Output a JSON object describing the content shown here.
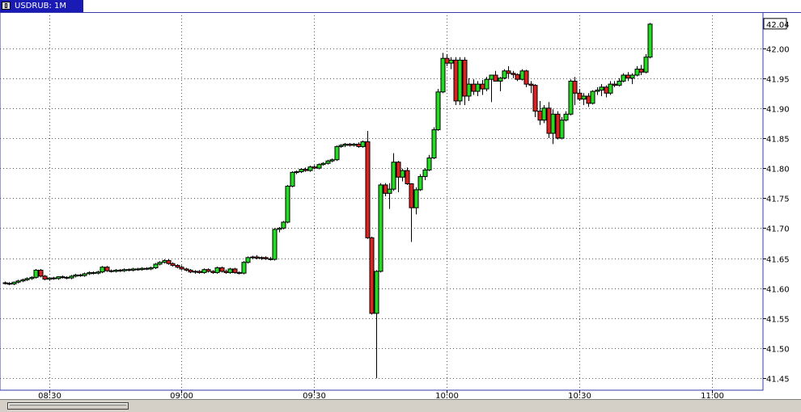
{
  "window": {
    "tab_label": "USDRUB: 1M"
  },
  "colors": {
    "up": "#22dd22",
    "down": "#dd2222",
    "grid": "#555555",
    "wick": "#000000",
    "axis": "#3a3aa8"
  },
  "chart_data": {
    "type": "candlestick",
    "symbol": "USDRUB",
    "timeframe": "1M",
    "ylim": [
      41.43,
      42.06
    ],
    "y_ticks": [
      "42.00",
      "41.95",
      "41.90",
      "41.85",
      "41.80",
      "41.75",
      "41.70",
      "41.65",
      "41.60",
      "41.55",
      "41.50",
      "41.45"
    ],
    "x_ticks": [
      {
        "label": "08:30",
        "minute": 10
      },
      {
        "label": "09:00",
        "minute": 40
      },
      {
        "label": "09:30",
        "minute": 70
      },
      {
        "label": "10:00",
        "minute": 100
      },
      {
        "label": "10:30",
        "minute": 130
      },
      {
        "label": "11:00",
        "minute": 160
      }
    ],
    "last_price": "42.04",
    "candles": [
      [
        41.608,
        41.611,
        41.606,
        41.609
      ],
      [
        41.608,
        41.61,
        41.605,
        41.607
      ],
      [
        41.607,
        41.611,
        41.605,
        41.61
      ],
      [
        41.61,
        41.614,
        41.608,
        41.612
      ],
      [
        41.612,
        41.616,
        41.61,
        41.614
      ],
      [
        41.614,
        41.618,
        41.612,
        41.616
      ],
      [
        41.616,
        41.62,
        41.614,
        41.618
      ],
      [
        41.618,
        41.632,
        41.616,
        41.63
      ],
      [
        41.63,
        41.632,
        41.618,
        41.62
      ],
      [
        41.62,
        41.622,
        41.613,
        41.615
      ],
      [
        41.615,
        41.618,
        41.613,
        41.617
      ],
      [
        41.617,
        41.619,
        41.614,
        41.616
      ],
      [
        41.616,
        41.62,
        41.614,
        41.619
      ],
      [
        41.619,
        41.621,
        41.616,
        41.618
      ],
      [
        41.618,
        41.62,
        41.615,
        41.617
      ],
      [
        41.617,
        41.622,
        41.615,
        41.62
      ],
      [
        41.62,
        41.624,
        41.618,
        41.622
      ],
      [
        41.622,
        41.624,
        41.619,
        41.621
      ],
      [
        41.621,
        41.626,
        41.619,
        41.624
      ],
      [
        41.624,
        41.628,
        41.622,
        41.626
      ],
      [
        41.626,
        41.628,
        41.623,
        41.625
      ],
      [
        41.625,
        41.629,
        41.623,
        41.627
      ],
      [
        41.627,
        41.637,
        41.625,
        41.635
      ],
      [
        41.635,
        41.637,
        41.627,
        41.629
      ],
      [
        41.629,
        41.631,
        41.626,
        41.628
      ],
      [
        41.628,
        41.632,
        41.626,
        41.63
      ],
      [
        41.63,
        41.632,
        41.627,
        41.629
      ],
      [
        41.629,
        41.633,
        41.627,
        41.631
      ],
      [
        41.631,
        41.633,
        41.628,
        41.63
      ],
      [
        41.63,
        41.634,
        41.628,
        41.632
      ],
      [
        41.632,
        41.634,
        41.629,
        41.631
      ],
      [
        41.631,
        41.635,
        41.629,
        41.633
      ],
      [
        41.633,
        41.635,
        41.63,
        41.632
      ],
      [
        41.632,
        41.636,
        41.63,
        41.634
      ],
      [
        41.634,
        41.642,
        41.632,
        41.64
      ],
      [
        41.64,
        41.645,
        41.638,
        41.643
      ],
      [
        41.643,
        41.648,
        41.641,
        41.646
      ],
      [
        41.646,
        41.648,
        41.639,
        41.641
      ],
      [
        41.641,
        41.643,
        41.636,
        41.638
      ],
      [
        41.638,
        41.64,
        41.633,
        41.635
      ],
      [
        41.635,
        41.638,
        41.63,
        41.632
      ],
      [
        41.632,
        41.634,
        41.628,
        41.63
      ],
      [
        41.63,
        41.632,
        41.625,
        41.627
      ],
      [
        41.627,
        41.63,
        41.624,
        41.628
      ],
      [
        41.628,
        41.63,
        41.624,
        41.626
      ],
      [
        41.626,
        41.633,
        41.624,
        41.631
      ],
      [
        41.631,
        41.633,
        41.626,
        41.628
      ],
      [
        41.628,
        41.63,
        41.624,
        41.626
      ],
      [
        41.626,
        41.636,
        41.624,
        41.634
      ],
      [
        41.634,
        41.636,
        41.626,
        41.628
      ],
      [
        41.628,
        41.631,
        41.624,
        41.626
      ],
      [
        41.626,
        41.634,
        41.624,
        41.632
      ],
      [
        41.632,
        41.634,
        41.624,
        41.626
      ],
      [
        41.626,
        41.628,
        41.623,
        41.625
      ],
      [
        41.625,
        41.645,
        41.623,
        41.643
      ],
      [
        41.643,
        41.653,
        41.641,
        41.651
      ],
      [
        41.651,
        41.654,
        41.648,
        41.652
      ],
      [
        41.652,
        41.655,
        41.648,
        41.65
      ],
      [
        41.65,
        41.653,
        41.647,
        41.651
      ],
      [
        41.651,
        41.653,
        41.647,
        41.649
      ],
      [
        41.649,
        41.652,
        41.646,
        41.648
      ],
      [
        41.648,
        41.7,
        41.646,
        41.698
      ],
      [
        41.698,
        41.702,
        41.693,
        41.7
      ],
      [
        41.7,
        41.712,
        41.698,
        41.71
      ],
      [
        41.71,
        41.772,
        41.708,
        41.77
      ],
      [
        41.77,
        41.795,
        41.768,
        41.793
      ],
      [
        41.793,
        41.796,
        41.79,
        41.794
      ],
      [
        41.794,
        41.8,
        41.792,
        41.798
      ],
      [
        41.798,
        41.801,
        41.794,
        41.796
      ],
      [
        41.796,
        41.804,
        41.794,
        41.802
      ],
      [
        41.802,
        41.805,
        41.798,
        41.8
      ],
      [
        41.8,
        41.808,
        41.798,
        41.806
      ],
      [
        41.806,
        41.81,
        41.804,
        41.808
      ],
      [
        41.808,
        41.814,
        41.806,
        41.812
      ],
      [
        41.812,
        41.816,
        41.81,
        41.814
      ],
      [
        41.814,
        41.838,
        41.812,
        41.836
      ],
      [
        41.836,
        41.84,
        41.834,
        41.838
      ],
      [
        41.838,
        41.842,
        41.835,
        41.84
      ],
      [
        41.84,
        41.842,
        41.836,
        41.838
      ],
      [
        41.838,
        41.842,
        41.836,
        41.84
      ],
      [
        41.84,
        41.843,
        41.834,
        41.836
      ],
      [
        41.836,
        41.846,
        41.834,
        41.844
      ],
      [
        41.844,
        41.862,
        41.682,
        41.684
      ],
      [
        41.684,
        41.686,
        41.556,
        41.558
      ],
      [
        41.558,
        41.63,
        41.45,
        41.628
      ],
      [
        41.628,
        41.775,
        41.626,
        41.772
      ],
      [
        41.772,
        41.775,
        41.753,
        41.758
      ],
      [
        41.758,
        41.775,
        41.732,
        41.765
      ],
      [
        41.765,
        41.825,
        41.762,
        41.81
      ],
      [
        41.81,
        41.812,
        41.76,
        41.785
      ],
      [
        41.785,
        41.799,
        41.778,
        41.796
      ],
      [
        41.796,
        41.801,
        41.772,
        41.774
      ],
      [
        41.774,
        41.775,
        41.677,
        41.734
      ],
      [
        41.734,
        41.768,
        41.723,
        41.764
      ],
      [
        41.764,
        41.79,
        41.762,
        41.786
      ],
      [
        41.786,
        41.8,
        41.78,
        41.797
      ],
      [
        41.797,
        41.822,
        41.795,
        41.817
      ],
      [
        41.817,
        41.868,
        41.815,
        41.864
      ],
      [
        41.864,
        41.932,
        41.862,
        41.927
      ],
      [
        41.927,
        41.992,
        41.925,
        41.983
      ],
      [
        41.983,
        41.99,
        41.97,
        41.975
      ],
      [
        41.975,
        41.985,
        41.965,
        41.98
      ],
      [
        41.98,
        41.985,
        41.905,
        41.912
      ],
      [
        41.912,
        41.985,
        41.905,
        41.98
      ],
      [
        41.98,
        41.985,
        41.905,
        41.92
      ],
      [
        41.92,
        41.95,
        41.912,
        41.94
      ],
      [
        41.94,
        41.948,
        41.922,
        41.928
      ],
      [
        41.928,
        41.945,
        41.92,
        41.94
      ],
      [
        41.94,
        41.947,
        41.922,
        41.932
      ],
      [
        41.932,
        41.952,
        41.928,
        41.948
      ],
      [
        41.948,
        41.952,
        41.91,
        41.955
      ],
      [
        41.955,
        41.962,
        41.948,
        41.945
      ],
      [
        41.945,
        41.952,
        41.928,
        41.95
      ],
      [
        41.95,
        41.965,
        41.948,
        41.962
      ],
      [
        41.962,
        41.97,
        41.95,
        41.958
      ],
      [
        41.958,
        41.962,
        41.95,
        41.956
      ],
      [
        41.956,
        41.958,
        41.945,
        41.948
      ],
      [
        41.948,
        41.965,
        41.946,
        41.962
      ],
      [
        41.962,
        41.964,
        41.935,
        41.94
      ],
      [
        41.94,
        41.945,
        41.925,
        41.938
      ],
      [
        41.938,
        41.94,
        41.885,
        41.895
      ],
      [
        41.895,
        41.912,
        41.872,
        41.88
      ],
      [
        41.88,
        41.905,
        41.875,
        41.9
      ],
      [
        41.9,
        41.91,
        41.85,
        41.858
      ],
      [
        41.858,
        41.898,
        41.84,
        41.89
      ],
      [
        41.89,
        41.895,
        41.848,
        41.85
      ],
      [
        41.85,
        41.885,
        41.848,
        41.88
      ],
      [
        41.88,
        41.895,
        41.878,
        41.89
      ],
      [
        41.89,
        41.948,
        41.888,
        41.945
      ],
      [
        41.945,
        41.952,
        41.905,
        41.925
      ],
      [
        41.925,
        41.932,
        41.912,
        41.915
      ],
      [
        41.915,
        41.925,
        41.905,
        41.92
      ],
      [
        41.92,
        41.925,
        41.902,
        41.908
      ],
      [
        41.908,
        41.93,
        41.906,
        41.928
      ],
      [
        41.928,
        41.935,
        41.922,
        41.93
      ],
      [
        41.93,
        41.94,
        41.92,
        41.935
      ],
      [
        41.935,
        41.938,
        41.918,
        41.925
      ],
      [
        41.925,
        41.945,
        41.922,
        41.94
      ],
      [
        41.94,
        41.945,
        41.935,
        41.938
      ],
      [
        41.938,
        41.95,
        41.936,
        41.945
      ],
      [
        41.945,
        41.958,
        41.943,
        41.955
      ],
      [
        41.955,
        41.96,
        41.945,
        41.95
      ],
      [
        41.95,
        41.958,
        41.94,
        41.955
      ],
      [
        41.955,
        41.97,
        41.953,
        41.965
      ],
      [
        41.965,
        41.972,
        41.955,
        41.96
      ],
      [
        41.96,
        41.99,
        41.958,
        41.985
      ],
      [
        41.985,
        42.042,
        41.983,
        42.04
      ]
    ]
  }
}
